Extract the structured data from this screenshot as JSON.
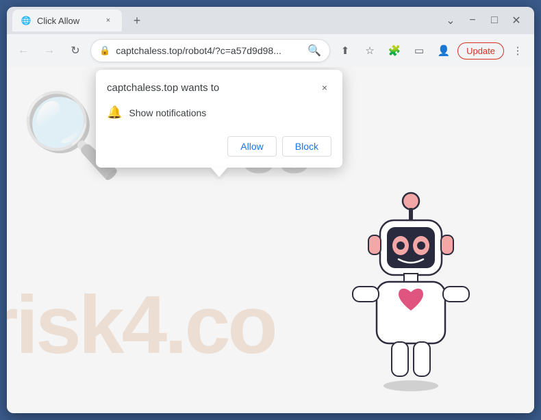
{
  "browser": {
    "title": "Click Allow",
    "tab": {
      "favicon": "🌐",
      "title": "Click Allow",
      "close_label": "×"
    },
    "new_tab_label": "+",
    "window_controls": {
      "minimize": "−",
      "maximize": "□",
      "close": "✕",
      "chevron": "⌄"
    },
    "toolbar": {
      "back_icon": "←",
      "forward_icon": "→",
      "reload_icon": "↻",
      "lock_icon": "🔒",
      "url": "captchaless.top/robot4/?c=a57d9d98...",
      "search_icon": "🔍",
      "share_icon": "⬆",
      "bookmark_icon": "☆",
      "extension_icon": "🧩",
      "sidebar_icon": "▭",
      "profile_icon": "👤",
      "update_label": "Update",
      "menu_icon": "⋮"
    }
  },
  "popup": {
    "title": "captchaless.top wants to",
    "close_label": "×",
    "notification_text": "Show notifications",
    "allow_label": "Allow",
    "block_label": "Block"
  },
  "page": {
    "ou_text": "OU",
    "watermark_text": "risk4.co"
  }
}
